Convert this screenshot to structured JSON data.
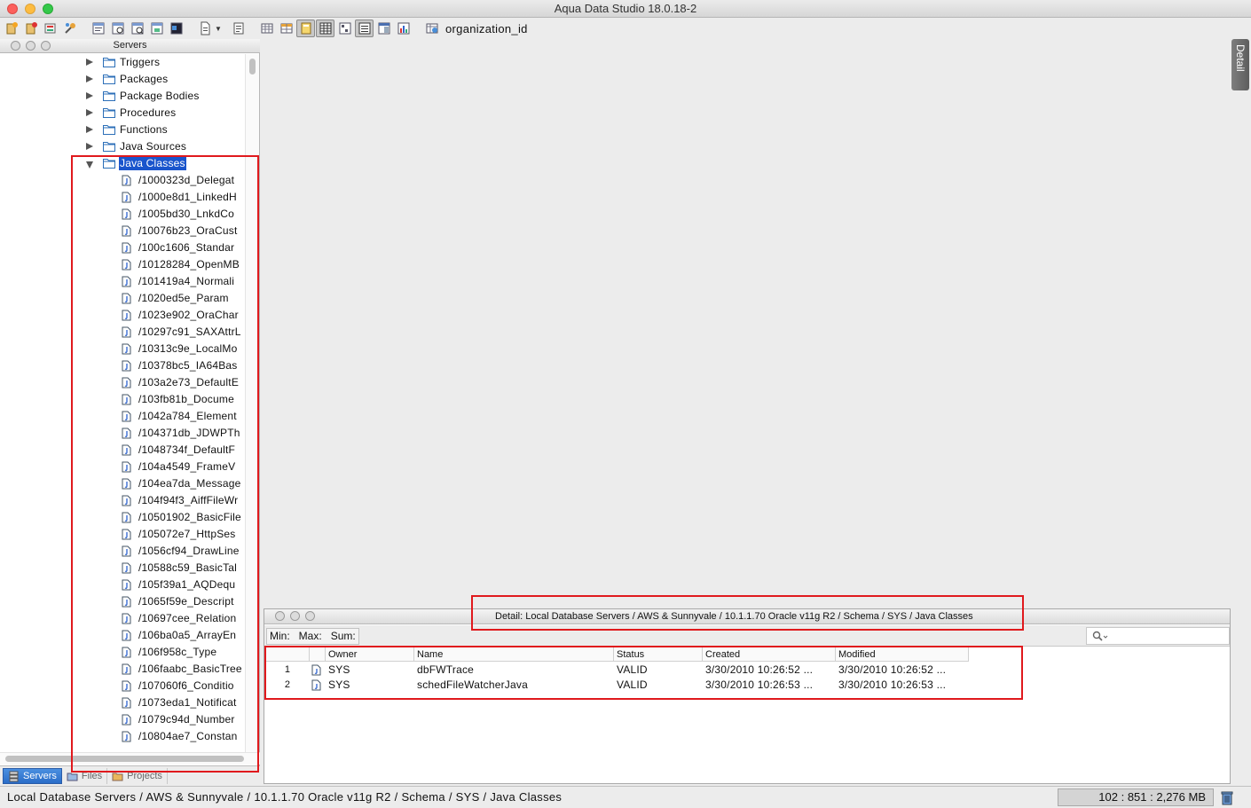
{
  "window": {
    "title": "Aqua Data Studio 18.0.18-2"
  },
  "toolbar": {
    "query_label": "organization_id",
    "buttons": [
      "new-server-icon",
      "remove-server-icon",
      "server-properties-icon",
      "tools-icon",
      "query-window-icon",
      "query-analyzer-icon",
      "schema-script-icon",
      "compare-icon",
      "shell-icon",
      "open-file-icon",
      "dropdown-arrow-icon",
      "history-icon",
      "table-data-icon",
      "table-editor-icon",
      "grid-view-icon",
      "detail-view-icon",
      "form-view-icon",
      "list-view-icon",
      "split-view-icon",
      "chart-view-icon"
    ]
  },
  "servers_panel": {
    "title": "Servers",
    "folders": [
      {
        "label": "Triggers",
        "expanded": false
      },
      {
        "label": "Packages",
        "expanded": false
      },
      {
        "label": "Package Bodies",
        "expanded": false
      },
      {
        "label": "Procedures",
        "expanded": false
      },
      {
        "label": "Functions",
        "expanded": false
      },
      {
        "label": "Java Sources",
        "expanded": false
      },
      {
        "label": "Java Classes",
        "expanded": true,
        "selected": true
      }
    ],
    "java_classes": [
      "/1000323d_Delegat",
      "/1000e8d1_LinkedH",
      "/1005bd30_LnkdCo",
      "/10076b23_OraCust",
      "/100c1606_Standar",
      "/10128284_OpenMB",
      "/101419a4_Normali",
      "/1020ed5e_Param",
      "/1023e902_OraChar",
      "/10297c91_SAXAttrL",
      "/10313c9e_LocalMo",
      "/10378bc5_IA64Bas",
      "/103a2e73_DefaultE",
      "/103fb81b_Docume",
      "/1042a784_Element",
      "/104371db_JDWPTh",
      "/1048734f_DefaultF",
      "/104a4549_FrameV",
      "/104ea7da_Message",
      "/104f94f3_AiffFileWr",
      "/10501902_BasicFile",
      "/105072e7_HttpSes",
      "/1056cf94_DrawLine",
      "/10588c59_BasicTal",
      "/105f39a1_AQDequ",
      "/1065f59e_Descript",
      "/10697cee_Relation",
      "/106ba0a5_ArrayEn",
      "/106f958c_Type",
      "/106faabc_BasicTree",
      "/107060f6_Conditio",
      "/1073eda1_Notificat",
      "/1079c94d_Number",
      "/10804ae7_Constan"
    ],
    "tabs": [
      {
        "label": "Servers",
        "icon": "servers-icon"
      },
      {
        "label": "Files",
        "icon": "files-icon"
      },
      {
        "label": "Projects",
        "icon": "projects-icon"
      }
    ]
  },
  "detail_side_tab": {
    "label": "Detail"
  },
  "detail_panel": {
    "title": "Detail: Local Database Servers / AWS & Sunnyvale / 10.1.1.70 Oracle v11g R2 / Schema / SYS / Java Classes",
    "stats": {
      "min": "Min:",
      "max": "Max:",
      "sum": "Sum:"
    },
    "search": {
      "placeholder": ""
    },
    "columns": [
      "Owner",
      "Name",
      "Status",
      "Created",
      "Modified"
    ],
    "rows": [
      {
        "num": "1",
        "owner": "SYS",
        "name": "dbFWTrace",
        "status": "VALID",
        "created": "3/30/2010 10:26:52 ...",
        "modified": "3/30/2010 10:26:52 ..."
      },
      {
        "num": "2",
        "owner": "SYS",
        "name": "schedFileWatcherJava",
        "status": "VALID",
        "created": "3/30/2010 10:26:53 ...",
        "modified": "3/30/2010 10:26:53 ..."
      }
    ]
  },
  "statusbar": {
    "path": "Local Database Servers / AWS & Sunnyvale / 10.1.1.70 Oracle  v11g R2 / Schema / SYS / Java Classes",
    "memory": "102 : 851 : 2,276 MB"
  },
  "colors": {
    "selection": "#1a55cc",
    "annotation": "#e0191d",
    "active_tab": "#2a6dc8"
  }
}
